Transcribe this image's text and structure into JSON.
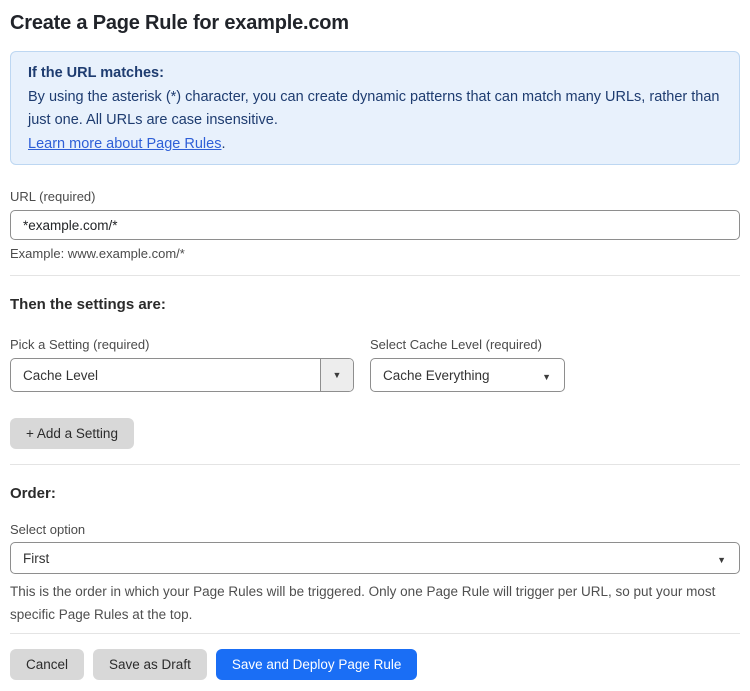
{
  "page": {
    "title": "Create a Page Rule for example.com"
  },
  "info_box": {
    "heading": "If the URL matches:",
    "body": "By using the asterisk (*) character, you can create dynamic patterns that can match many URLs, rather than just one. All URLs are case insensitive.",
    "link": "Learn more about Page Rules",
    "link_suffix": "."
  },
  "url_field": {
    "label": "URL (required)",
    "value": "*example.com/*",
    "example": "Example: www.example.com/*"
  },
  "settings": {
    "heading": "Then the settings are:",
    "pick_setting": {
      "label": "Pick a Setting (required)",
      "value": "Cache Level"
    },
    "cache_level": {
      "label": "Select Cache Level (required)",
      "value": "Cache Everything"
    },
    "add_button": "+ Add a Setting"
  },
  "order": {
    "heading": "Order:",
    "label": "Select option",
    "value": "First",
    "help": "This is the order in which your Page Rules will be triggered. Only one Page Rule will trigger per URL, so put your most specific Page Rules at the top."
  },
  "actions": {
    "cancel": "Cancel",
    "save_draft": "Save as Draft",
    "save_deploy": "Save and Deploy Page Rule"
  },
  "icons": {
    "caret_down": "▼"
  },
  "colors": {
    "accent_blue": "#1a6ef5",
    "info_background": "#e8f1fc",
    "info_border": "#bdd7f2",
    "info_text": "#1e3c70",
    "link_blue": "#2e5fd7",
    "button_gray": "#d8d8d8"
  }
}
